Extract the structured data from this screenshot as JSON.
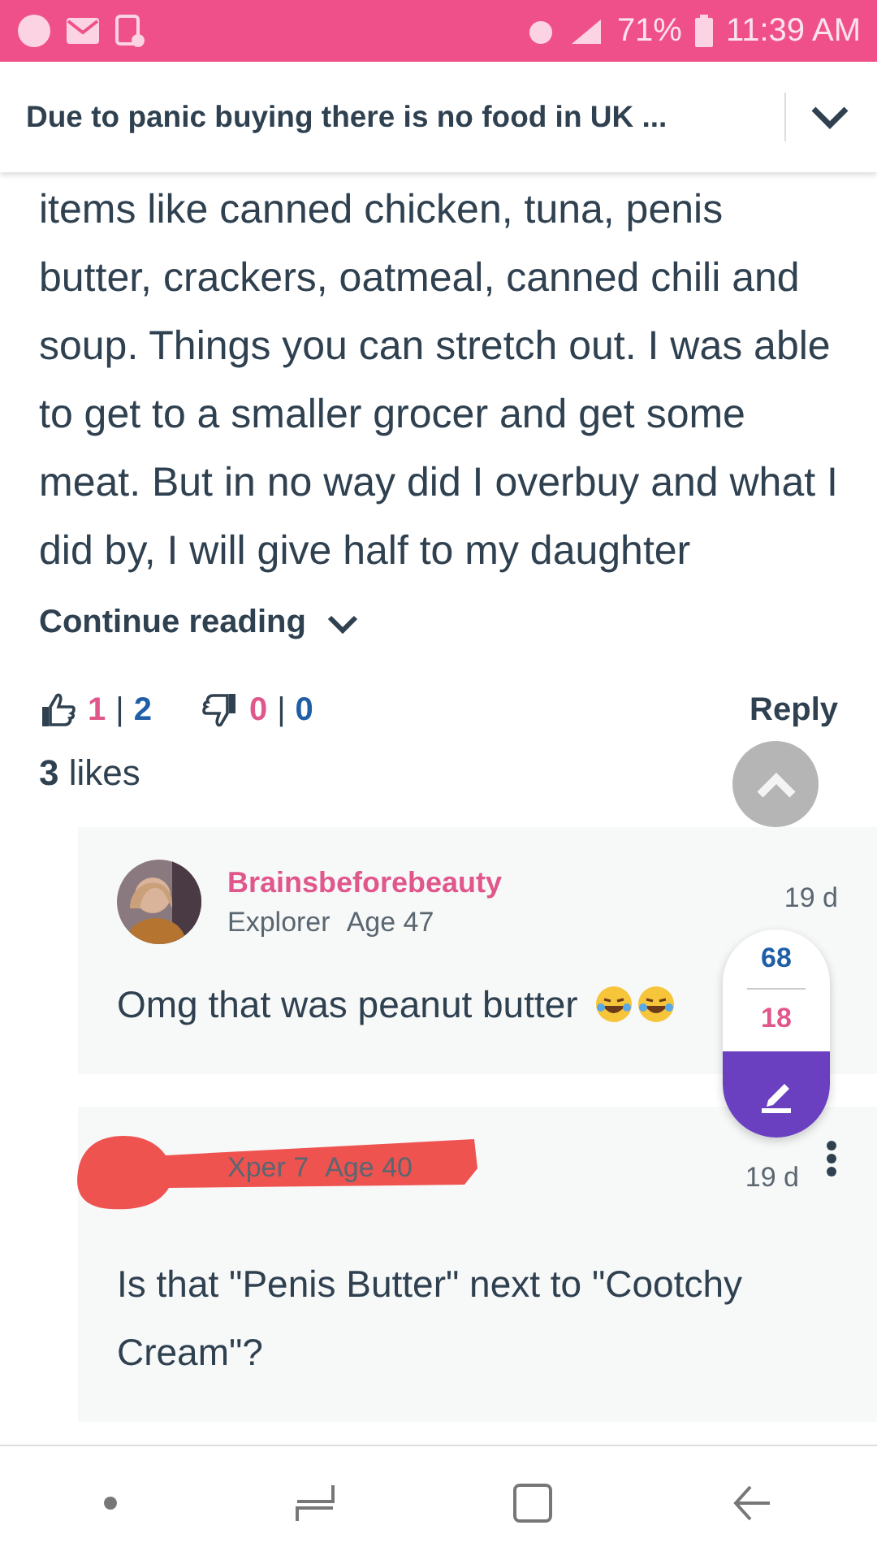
{
  "status_bar": {
    "battery": "71%",
    "time": "11:39 AM"
  },
  "header": {
    "title": "Due to panic buying there is no food in UK ..."
  },
  "post": {
    "body": "items like canned chicken, tuna, penis butter, crackers, oatmeal, canned chili and soup. Things you can stretch out. I was able to get to a smaller grocer and get some meat. But in no way did I overbuy and what I did by, I will give half to my daughter",
    "continue": "Continue reading",
    "upvotes": {
      "own": "1",
      "sep": "|",
      "total": "2"
    },
    "downvotes": {
      "own": "0",
      "sep": "|",
      "total": "0"
    },
    "reply": "Reply",
    "likes": "**3** likes"
  },
  "replies": [
    {
      "author": "Brainsbeforebeauty",
      "rank": "Explorer",
      "age": "Age 47",
      "time": "19 d",
      "text": "Omg that was peanut butter",
      "emoji_icons": true,
      "redacted": false,
      "menu": false
    },
    {
      "rank": "Xper 7",
      "age": "Age 40",
      "time": "19 d",
      "text": "Is that \"Penis Butter\" next to \"Cootchy Cream\"?",
      "emoji_icons": false,
      "redacted": true,
      "menu": true
    }
  ],
  "vote_widget": {
    "up": "68",
    "down": "18"
  }
}
